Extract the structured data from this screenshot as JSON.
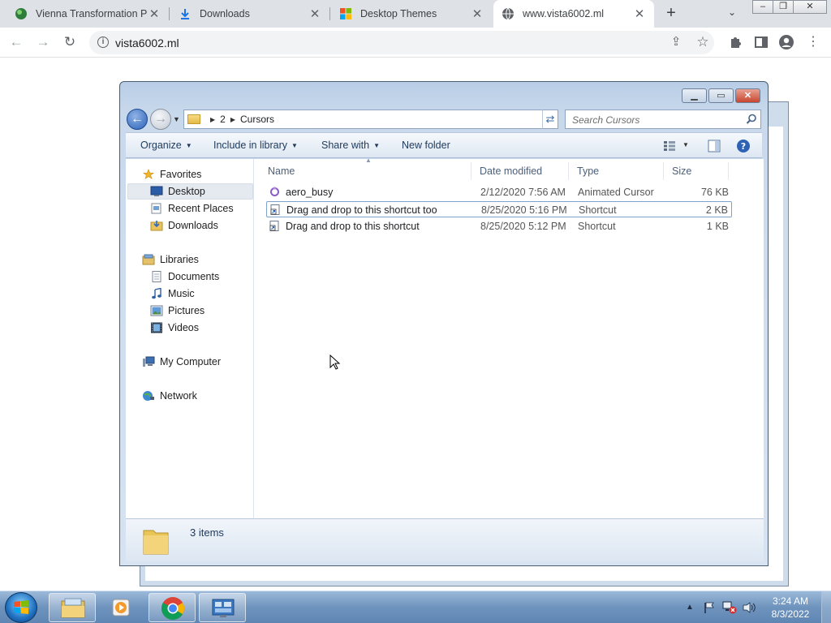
{
  "browser": {
    "tabs": [
      {
        "title": "Vienna Transformation Pa",
        "icon": "vienna-globe-icon",
        "active": false
      },
      {
        "title": "Downloads",
        "icon": "download-icon",
        "active": false
      },
      {
        "title": "Desktop Themes",
        "icon": "windows-logo-icon",
        "active": false
      },
      {
        "title": "www.vista6002.ml",
        "icon": "globe-icon",
        "active": true
      }
    ],
    "url": "vista6002.ml"
  },
  "explorer": {
    "breadcrumb": [
      "2",
      "Cursors"
    ],
    "search_placeholder": "Search Cursors",
    "commands": {
      "organize": "Organize",
      "include_in_library": "Include in library",
      "share_with": "Share with",
      "new_folder": "New folder"
    },
    "nav": {
      "favorites": "Favorites",
      "desktop": "Desktop",
      "recent_places": "Recent Places",
      "downloads": "Downloads",
      "libraries": "Libraries",
      "documents": "Documents",
      "music": "Music",
      "pictures": "Pictures",
      "videos": "Videos",
      "my_computer": "My Computer",
      "network": "Network"
    },
    "columns": {
      "name": "Name",
      "date": "Date modified",
      "type": "Type",
      "size": "Size"
    },
    "files": [
      {
        "name": "aero_busy",
        "date": "2/12/2020 7:56 AM",
        "type": "Animated Cursor",
        "size": "76 KB",
        "icon": "animated-cursor-icon"
      },
      {
        "name": "Drag and drop to this shortcut too",
        "date": "8/25/2020 5:16 PM",
        "type": "Shortcut",
        "size": "2 KB",
        "icon": "shortcut-icon"
      },
      {
        "name": "Drag and drop to this shortcut",
        "date": "8/25/2020 5:12 PM",
        "type": "Shortcut",
        "size": "1 KB",
        "icon": "shortcut-icon"
      }
    ],
    "status": "3 items"
  },
  "taskbar": {
    "time": "3:24 AM",
    "date": "8/3/2022"
  }
}
